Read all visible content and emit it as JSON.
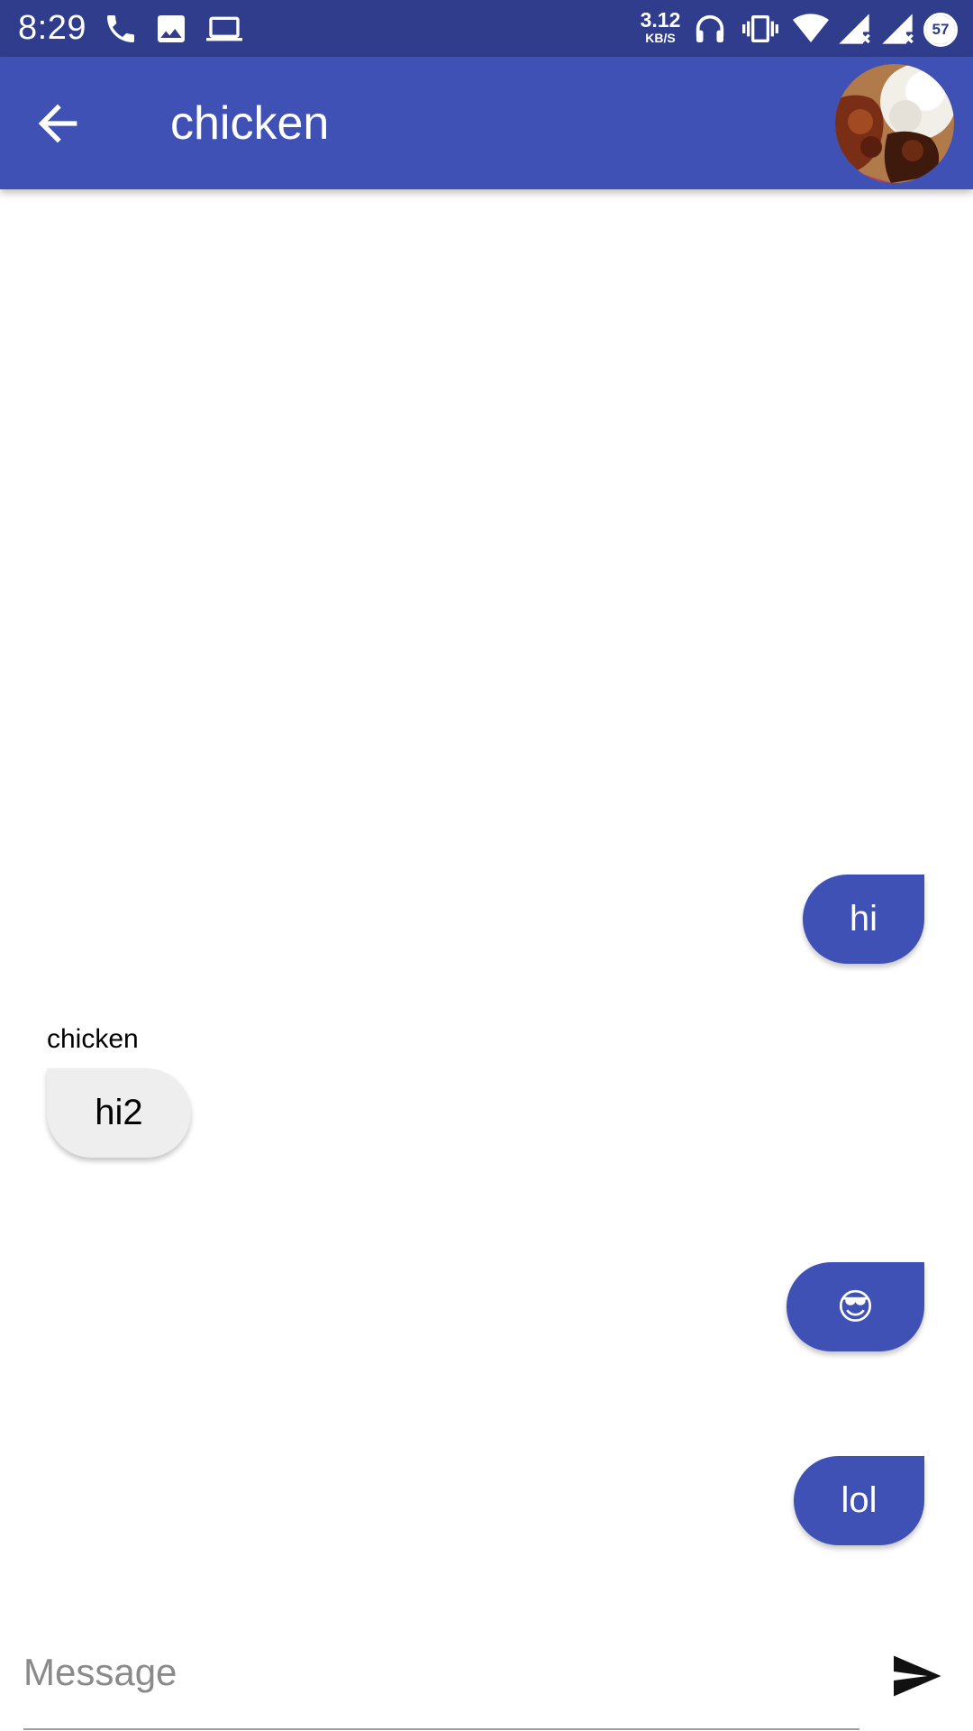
{
  "status_bar": {
    "time": "8:29",
    "net_speed": "3.12",
    "net_speed_unit": "KB/S",
    "battery_level": "57",
    "icons": [
      "phone-icon",
      "image-icon",
      "laptop-icon",
      "headphones-icon",
      "vibrate-icon",
      "wifi-icon",
      "cell-signal-icon",
      "cell-signal-icon",
      "battery-icon"
    ]
  },
  "app_bar": {
    "title": "chicken",
    "back_icon": "arrow-back-icon",
    "avatar": "food-photo-avatar"
  },
  "messages": [
    {
      "direction": "outgoing",
      "text": "hi"
    },
    {
      "direction": "incoming",
      "sender": "chicken",
      "text": "hi2"
    },
    {
      "direction": "outgoing",
      "text": "😎"
    },
    {
      "direction": "outgoing",
      "text": "lol"
    }
  ],
  "composer": {
    "placeholder": "Message",
    "value": "",
    "send_icon": "send-icon"
  },
  "colors": {
    "status_bar": "#2f3d8c",
    "primary": "#3f51b5",
    "incoming_bubble": "#eeeeee",
    "background": "#ffffff"
  }
}
